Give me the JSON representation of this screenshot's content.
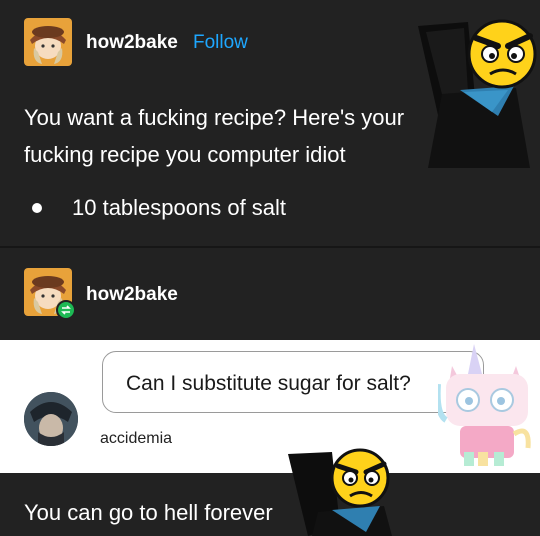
{
  "post": {
    "username": "how2bake",
    "follow_label": "Follow",
    "line1": "You want a fucking recipe? Here's your",
    "line2": "fucking recipe you computer idiot",
    "bullet": "10 tablespoons of salt"
  },
  "reblog": {
    "username": "how2bake",
    "icon": "reblog-icon"
  },
  "ask": {
    "question": "Can I substitute sugar for salt?",
    "asker": "accidemia"
  },
  "answer": {
    "text": "You can go to hell forever"
  },
  "colors": {
    "background": "#222222",
    "follow": "#1ea7ff",
    "reblog_badge": "#1db954",
    "ask_background": "#ffffff"
  }
}
